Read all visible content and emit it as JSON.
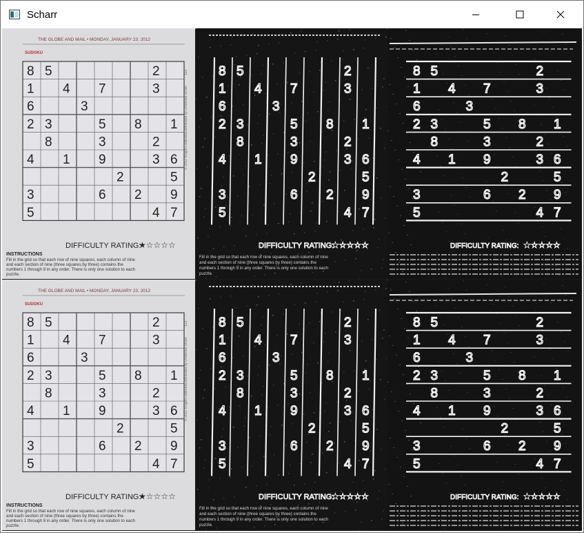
{
  "window": {
    "title": "Scharr",
    "controls": {
      "minimize": "minimize-icon",
      "maximize": "maximize-icon",
      "close": "close-icon"
    }
  },
  "newspaper": {
    "masthead": "THE GLOBE AND MAIL  •  MONDAY, JANUARY 23, 2012",
    "section": "SUDOKU",
    "page_number": "123",
    "credit": "© 2012 Knight Features/Distributed by Universal Uclick",
    "difficulty_label": "DIFFICULTY RATING:",
    "difficulty_stars": "★☆☆☆☆",
    "instructions_heading": "INSTRUCTIONS",
    "instructions_lines": [
      "Fill in the grid so that each row of nine squares, each column of nine",
      "and each section of nine (three squares by three) contains the",
      "numbers 1 through 9 in any order. There is only one solution to each",
      "puzzle."
    ],
    "grid": [
      [
        "8",
        "5",
        "",
        "",
        "",
        "",
        "",
        "2",
        ""
      ],
      [
        "1",
        "",
        "4",
        "",
        "7",
        "",
        "",
        "3",
        ""
      ],
      [
        "6",
        "",
        "",
        "3",
        "",
        "",
        "",
        "",
        ""
      ],
      [
        "2",
        "3",
        "",
        "",
        "5",
        "",
        "8",
        "",
        "1"
      ],
      [
        "",
        "8",
        "",
        "",
        "3",
        "",
        "",
        "2",
        ""
      ],
      [
        "4",
        "",
        "1",
        "",
        "9",
        "",
        "",
        "3",
        "6"
      ],
      [
        "",
        "",
        "",
        "",
        "",
        "2",
        "",
        "",
        "5"
      ],
      [
        "3",
        "",
        "",
        "",
        "6",
        "",
        "2",
        "",
        "9"
      ],
      [
        "5",
        "",
        "",
        "",
        "",
        "",
        "",
        "4",
        "7"
      ]
    ]
  },
  "panels": [
    {
      "name": "original",
      "accent": "#dcdcde"
    },
    {
      "name": "scharr-x",
      "accent": "#161616"
    },
    {
      "name": "scharr-y",
      "accent": "#141414"
    }
  ]
}
